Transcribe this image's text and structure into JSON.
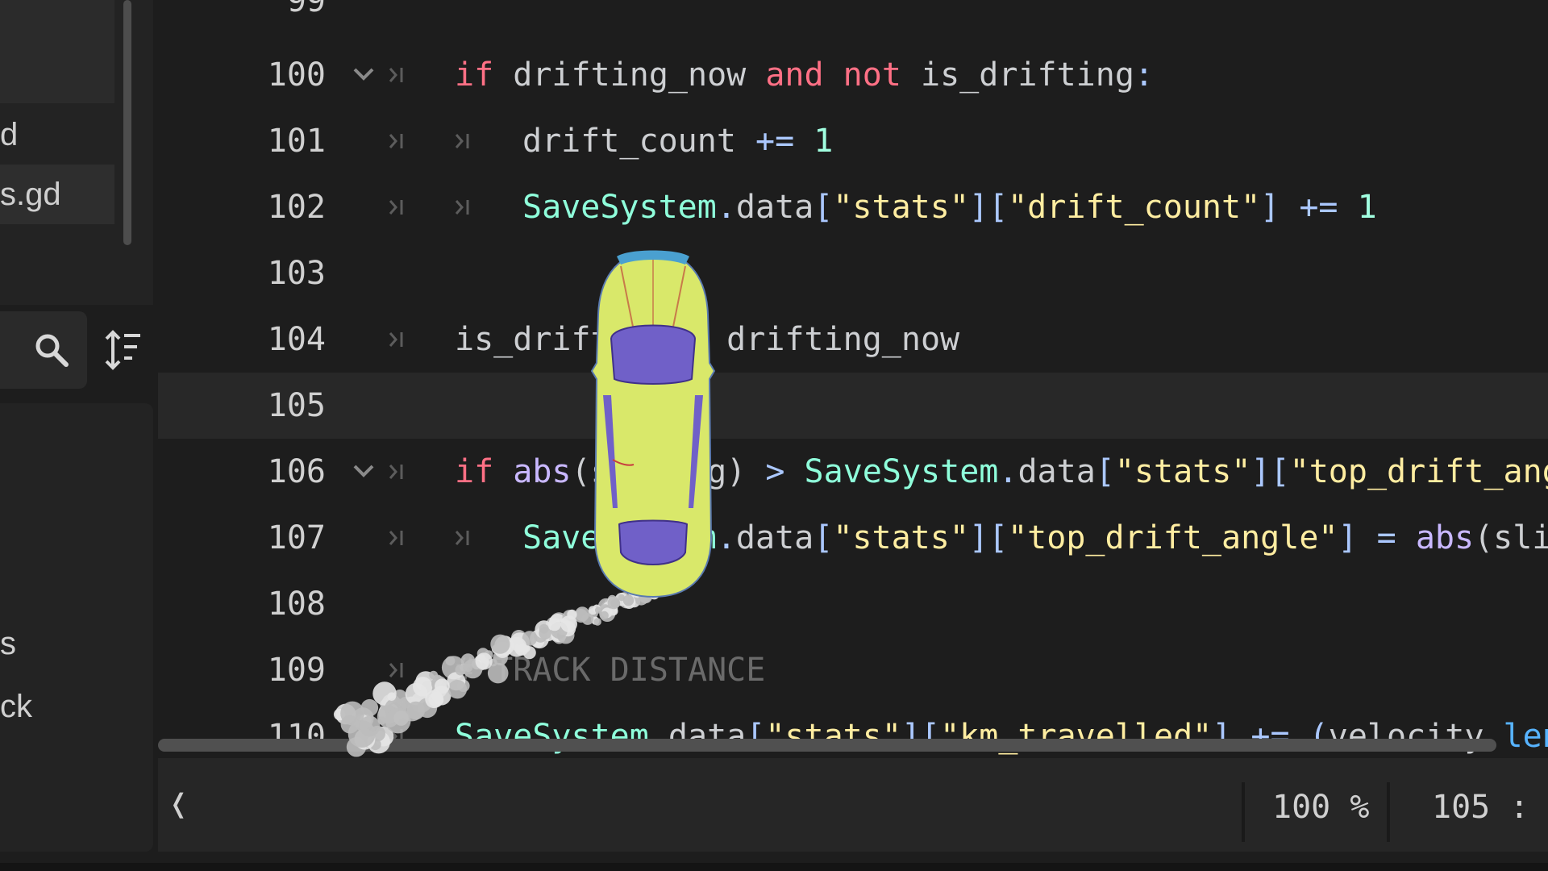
{
  "file_panel": {
    "items": [
      {
        "label": "d",
        "selected": false
      },
      {
        "label": "s.gd",
        "selected": true
      }
    ],
    "lower_items": [
      "s",
      "ck"
    ]
  },
  "editor": {
    "top_partial_line": "99",
    "lines": [
      {
        "number": "100",
        "fold": true,
        "indent": 0,
        "tokens": [
          {
            "t": "if",
            "c": "kw"
          },
          {
            "t": " drifting_now ",
            "c": "id"
          },
          {
            "t": "and",
            "c": "kw"
          },
          {
            "t": " ",
            "c": "id"
          },
          {
            "t": "not",
            "c": "kw"
          },
          {
            "t": " is_drifting",
            "c": "id"
          },
          {
            "t": ":",
            "c": "sym"
          }
        ]
      },
      {
        "number": "101",
        "fold": false,
        "indent": 1,
        "tokens": [
          {
            "t": "drift_count",
            "c": "id"
          },
          {
            "t": " += ",
            "c": "sym"
          },
          {
            "t": "1",
            "c": "num"
          }
        ]
      },
      {
        "number": "102",
        "fold": false,
        "indent": 1,
        "tokens": [
          {
            "t": "SaveSystem",
            "c": "cls"
          },
          {
            "t": ".",
            "c": "sym"
          },
          {
            "t": "data",
            "c": "id"
          },
          {
            "t": "[",
            "c": "sym"
          },
          {
            "t": "\"stats\"",
            "c": "str"
          },
          {
            "t": "][",
            "c": "sym"
          },
          {
            "t": "\"drift_count\"",
            "c": "str"
          },
          {
            "t": "] += ",
            "c": "sym"
          },
          {
            "t": "1",
            "c": "num"
          }
        ]
      },
      {
        "number": "103",
        "fold": false,
        "indent": -1,
        "tokens": []
      },
      {
        "number": "104",
        "fold": false,
        "indent": 0,
        "tokens": [
          {
            "t": "is_drifting = drifting_now",
            "c": "id"
          }
        ]
      },
      {
        "number": "105",
        "fold": false,
        "indent": -1,
        "current": true,
        "tokens": []
      },
      {
        "number": "106",
        "fold": true,
        "indent": 0,
        "tokens": [
          {
            "t": "if",
            "c": "kw"
          },
          {
            "t": " ",
            "c": "id"
          },
          {
            "t": "abs",
            "c": "fn"
          },
          {
            "t": "(sliding) ",
            "c": "id"
          },
          {
            "t": ">",
            "c": "sym"
          },
          {
            "t": " ",
            "c": "id"
          },
          {
            "t": "SaveSystem",
            "c": "cls"
          },
          {
            "t": ".",
            "c": "sym"
          },
          {
            "t": "data",
            "c": "id"
          },
          {
            "t": "[",
            "c": "sym"
          },
          {
            "t": "\"stats\"",
            "c": "str"
          },
          {
            "t": "][",
            "c": "sym"
          },
          {
            "t": "\"top_drift_angle\"",
            "c": "str"
          },
          {
            "t": "]:",
            "c": "sym"
          }
        ]
      },
      {
        "number": "107",
        "fold": false,
        "indent": 1,
        "tokens": [
          {
            "t": "SaveSystem",
            "c": "cls"
          },
          {
            "t": ".",
            "c": "sym"
          },
          {
            "t": "data",
            "c": "id"
          },
          {
            "t": "[",
            "c": "sym"
          },
          {
            "t": "\"stats\"",
            "c": "str"
          },
          {
            "t": "][",
            "c": "sym"
          },
          {
            "t": "\"top_drift_angle\"",
            "c": "str"
          },
          {
            "t": "] = ",
            "c": "sym"
          },
          {
            "t": "abs",
            "c": "fn"
          },
          {
            "t": "(sliding)",
            "c": "id"
          }
        ]
      },
      {
        "number": "108",
        "fold": false,
        "indent": -1,
        "tokens": []
      },
      {
        "number": "109",
        "fold": false,
        "indent": 0,
        "tokens": [
          {
            "t": "# TRACK DISTANCE",
            "c": "cmt"
          }
        ]
      },
      {
        "number": "110",
        "fold": false,
        "indent": 0,
        "tokens": [
          {
            "t": "SaveSystem",
            "c": "cls"
          },
          {
            "t": ".",
            "c": "sym"
          },
          {
            "t": "data",
            "c": "id"
          },
          {
            "t": "[",
            "c": "sym"
          },
          {
            "t": "\"stats\"",
            "c": "str"
          },
          {
            "t": "][",
            "c": "sym"
          },
          {
            "t": "\"km_travelled\"",
            "c": "str"
          },
          {
            "t": "] += (",
            "c": "sym"
          },
          {
            "t": "velocity",
            "c": "id"
          },
          {
            "t": ".",
            "c": "sym"
          },
          {
            "t": "length",
            "c": "method"
          },
          {
            "t": "() *",
            "c": "sym"
          }
        ]
      }
    ]
  },
  "statusbar": {
    "back_glyph": "❬",
    "zoom": "100 %",
    "position": "105 :"
  },
  "colors": {
    "background": "#1d1d1d",
    "keyword": "#ff7085",
    "string": "#ffeda1",
    "number": "#a1ffe0",
    "class": "#8fffdb",
    "builtin": "#c9b8ff",
    "method": "#57b3ff",
    "comment": "#6a6a6a",
    "car_body": "#d9e86a",
    "car_glass": "#7060c8"
  }
}
